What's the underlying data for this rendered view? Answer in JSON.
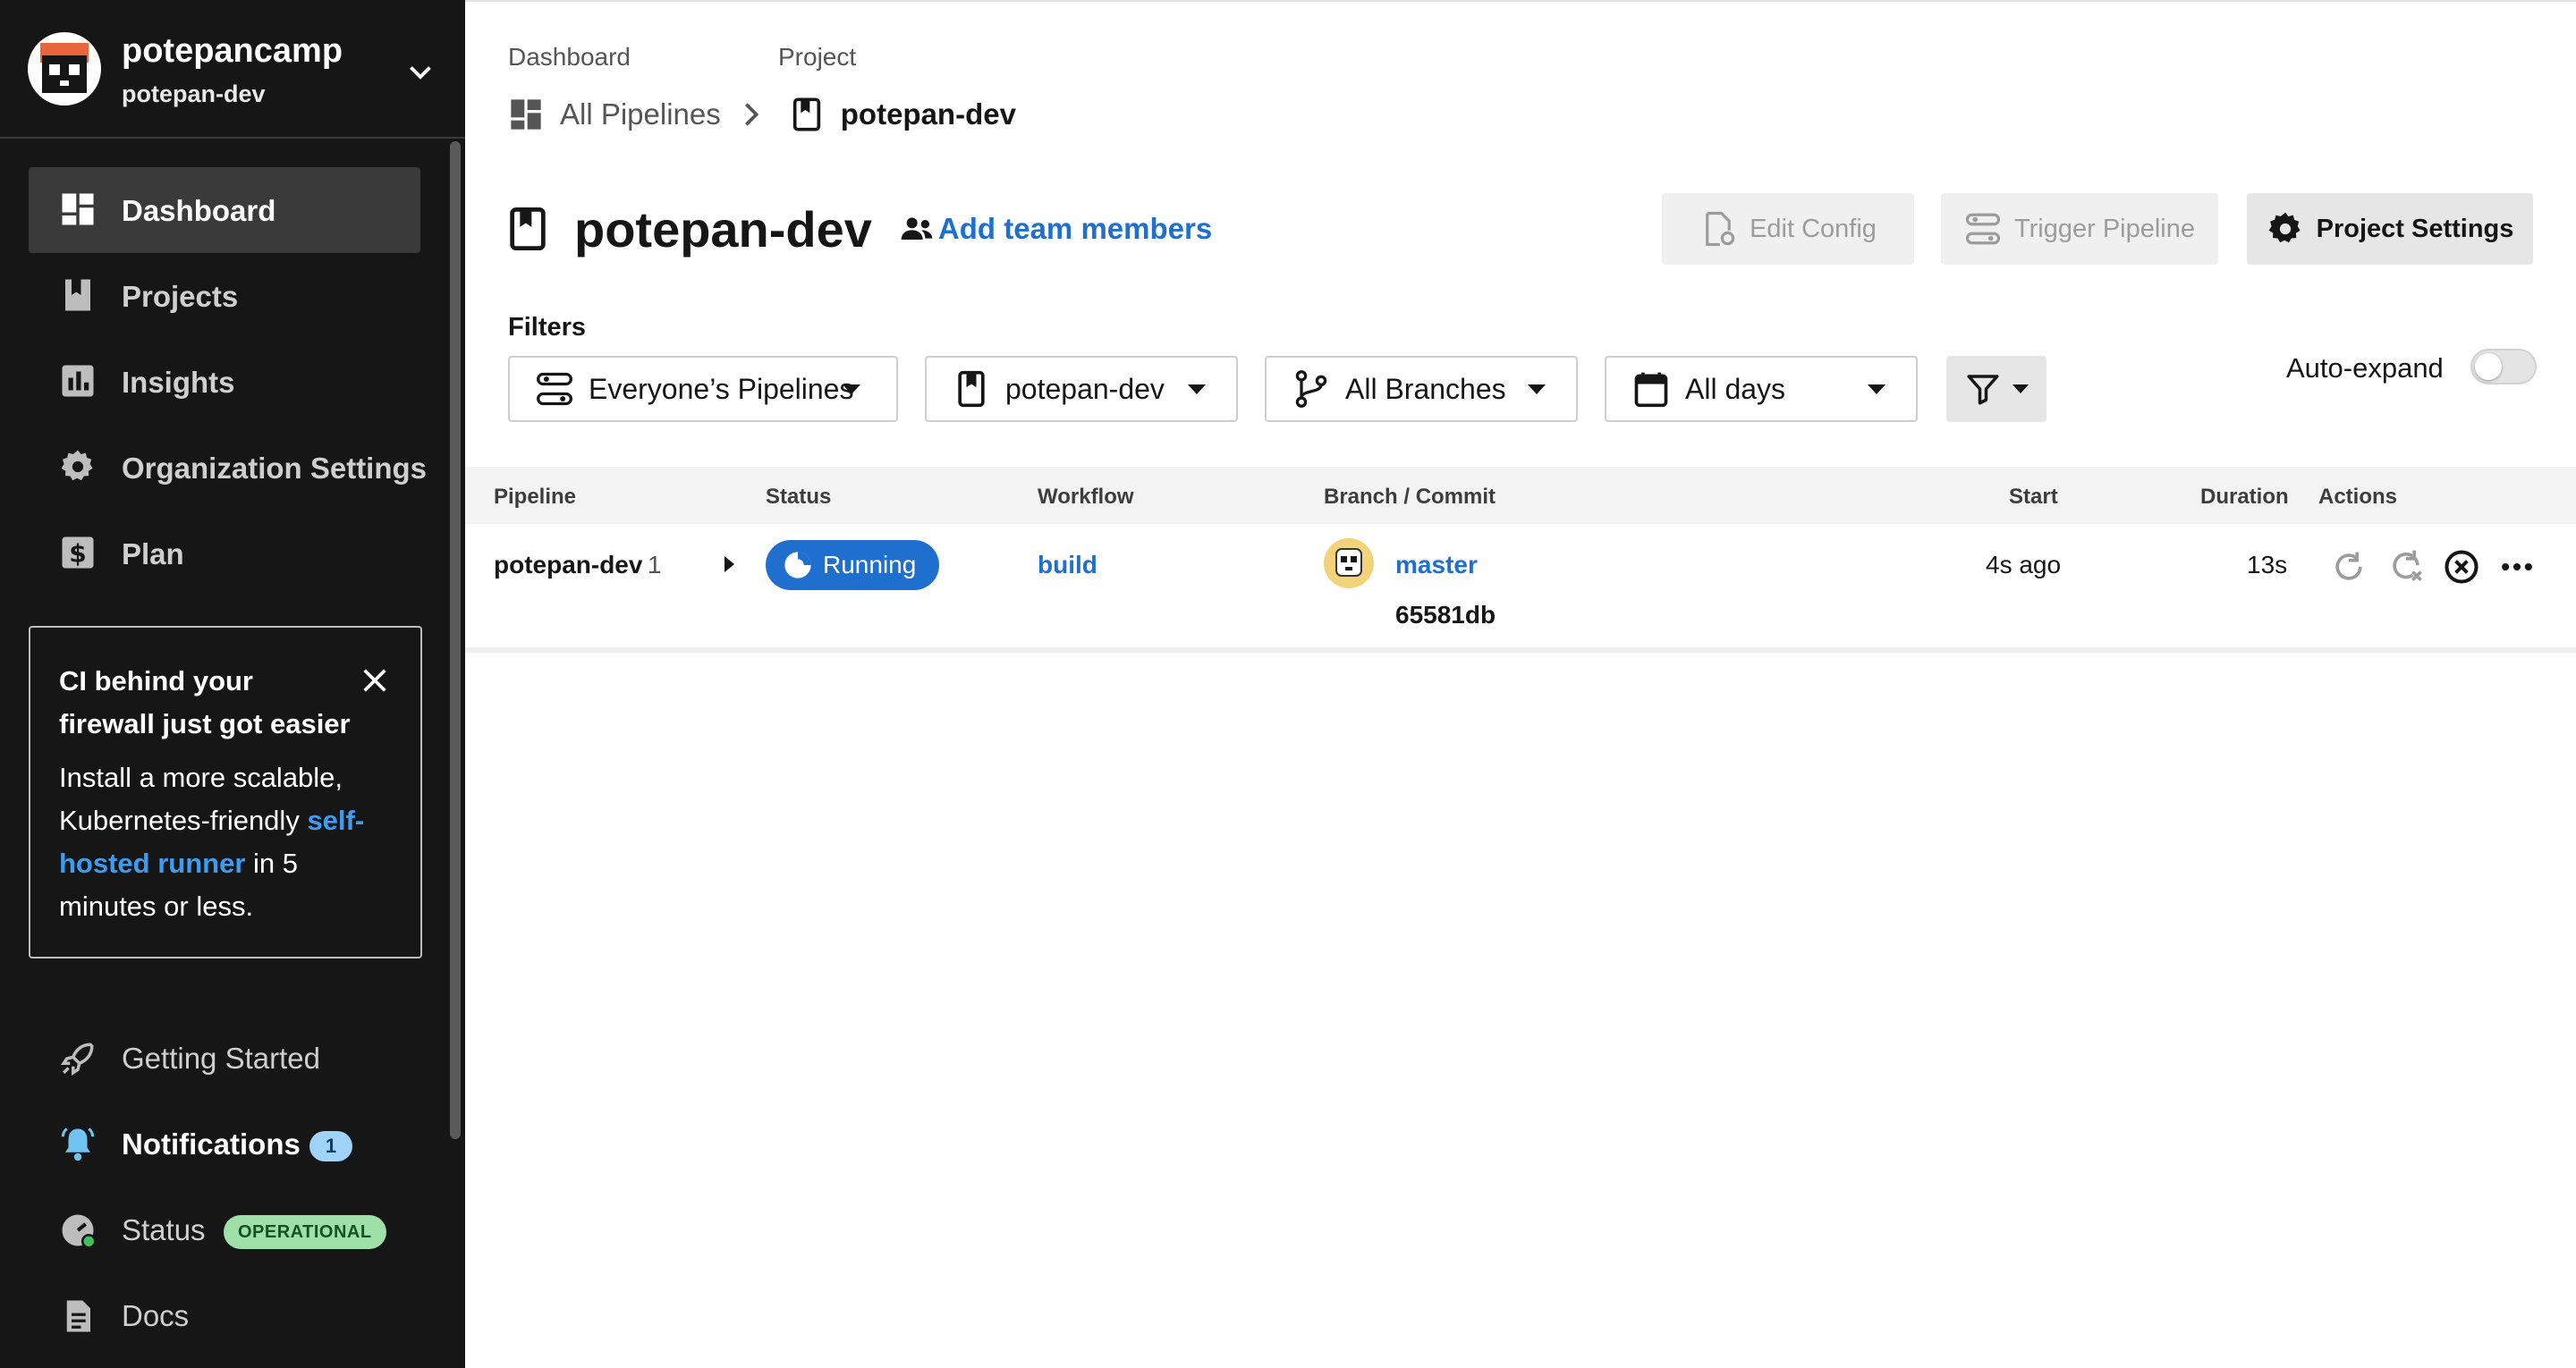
{
  "sidebar": {
    "org_name": "potepancamp",
    "org_sub": "potepan-dev",
    "nav": [
      {
        "label": "Dashboard",
        "icon": "dashboard-icon",
        "active": true
      },
      {
        "label": "Projects",
        "icon": "bookmark-icon"
      },
      {
        "label": "Insights",
        "icon": "bar-chart-icon"
      },
      {
        "label": "Organization Settings",
        "icon": "gear-icon"
      },
      {
        "label": "Plan",
        "icon": "dollar-icon"
      }
    ],
    "promo": {
      "title": "CI behind your firewall just got easier",
      "body_before": "Install a more scalable, Kubernetes-friendly ",
      "link": "self-hosted runner",
      "body_after": " in 5 minutes or less."
    },
    "bottom": {
      "getting_started": "Getting Started",
      "notifications": "Notifications",
      "notif_count": "1",
      "status": "Status",
      "status_badge": "OPERATIONAL",
      "docs": "Docs"
    }
  },
  "breadcrumb": {
    "dashboard_head": "Dashboard",
    "project_head": "Project",
    "all_pipelines": "All Pipelines",
    "project": "potepan-dev"
  },
  "header": {
    "title": "potepan-dev",
    "add_team": "Add team members",
    "edit_config": "Edit Config",
    "trigger_pipeline": "Trigger Pipeline",
    "project_settings": "Project Settings"
  },
  "filters": {
    "label": "Filters",
    "pipelines": "Everyone’s Pipelines",
    "project": "potepan-dev",
    "branches": "All Branches",
    "days": "All days",
    "auto_expand": "Auto-expand",
    "auto_expand_on": false
  },
  "table": {
    "headers": {
      "pipeline": "Pipeline",
      "status": "Status",
      "workflow": "Workflow",
      "branch_commit": "Branch / Commit",
      "start": "Start",
      "duration": "Duration",
      "actions": "Actions"
    },
    "rows": [
      {
        "pipeline": "potepan-dev",
        "number": "1",
        "status": "Running",
        "workflow": "build",
        "branch": "master",
        "commit": "65581db",
        "start": "4s ago",
        "duration": "13s"
      }
    ]
  },
  "colors": {
    "sidebar_bg": "#161616",
    "link_blue": "#1f6fcf",
    "running_blue": "#1f6fcf",
    "status_green": "#9fe0a9",
    "notif_badge": "#9fd4f8"
  }
}
